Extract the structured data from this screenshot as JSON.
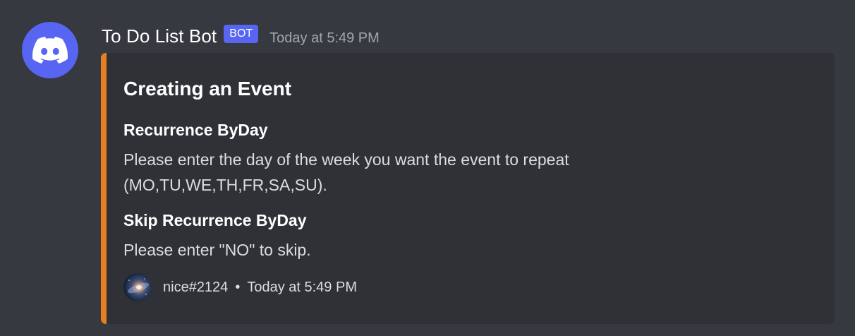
{
  "message": {
    "author": "To Do List Bot",
    "bot_tag": "BOT",
    "timestamp": "Today at 5:49 PM",
    "avatar_icon": "discord-logo-icon"
  },
  "embed": {
    "accent_color": "#e67e22",
    "title": "Creating an Event",
    "fields": [
      {
        "name": "Recurrence ByDay",
        "value_lines": [
          "Please enter the day of the week you want the event to repeat",
          "(MO,TU,WE,TH,FR,SA,SU)."
        ]
      },
      {
        "name": "Skip Recurrence ByDay",
        "value_lines": [
          "Please enter \"NO\" to skip."
        ]
      }
    ],
    "footer": {
      "text": "nice#2124",
      "separator": "•",
      "timestamp": "Today at 5:49 PM",
      "icon": "galaxy-avatar-icon"
    }
  },
  "colors": {
    "background": "#36393f",
    "embed_background": "#2f3136",
    "bot_tag": "#5865f2",
    "avatar": "#5865f2"
  }
}
